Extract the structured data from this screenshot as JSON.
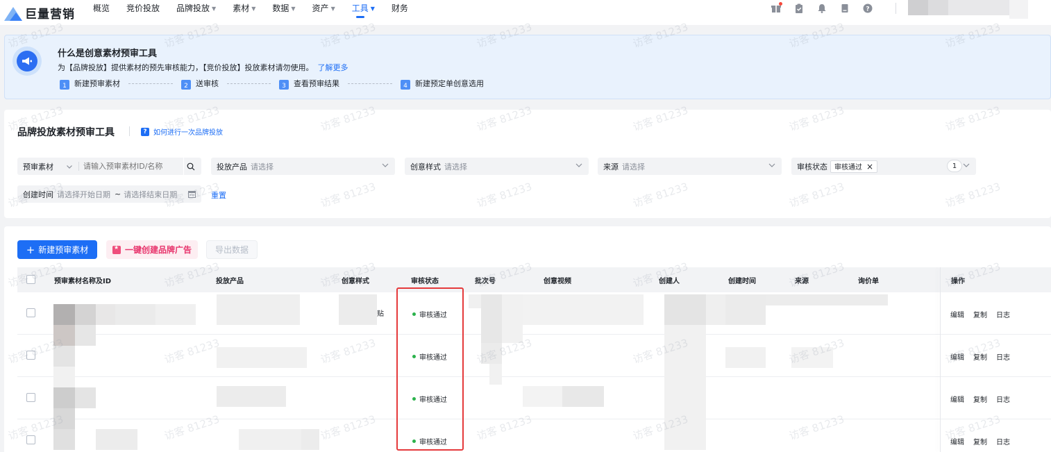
{
  "brand": {
    "name": "巨量营销"
  },
  "nav": {
    "items": [
      {
        "label": "概览",
        "dropdown": false
      },
      {
        "label": "竞价投放",
        "dropdown": false
      },
      {
        "label": "品牌投放",
        "dropdown": true
      },
      {
        "label": "素材",
        "dropdown": true
      },
      {
        "label": "数据",
        "dropdown": true
      },
      {
        "label": "资产",
        "dropdown": true
      },
      {
        "label": "工具",
        "dropdown": true,
        "active": true
      },
      {
        "label": "财务",
        "dropdown": false
      }
    ],
    "right_icons": [
      "gift-icon",
      "clipboard-icon",
      "bell-icon",
      "document-icon",
      "help-icon"
    ]
  },
  "banner": {
    "title": "什么是创意素材预审工具",
    "desc": "为【品牌投放】提供素材的预先审核能力，【竞价投放】投放素材请勿使用。",
    "link": "了解更多",
    "steps": [
      {
        "num": "1",
        "label": "新建预审素材"
      },
      {
        "num": "2",
        "label": "送审核"
      },
      {
        "num": "3",
        "label": "查看预审结果"
      },
      {
        "num": "4",
        "label": "新建预定单创意选用"
      }
    ]
  },
  "filters": {
    "title": "品牌投放素材预审工具",
    "howto": "如何进行一次品牌投放",
    "material": {
      "label": "预审素材",
      "placeholder": "请输入预审素材ID/名称"
    },
    "product": {
      "label": "投放产品",
      "placeholder": "请选择"
    },
    "style": {
      "label": "创意样式",
      "placeholder": "请选择"
    },
    "source": {
      "label": "来源",
      "placeholder": "请选择"
    },
    "status": {
      "label": "审核状态",
      "tag": "审核通过",
      "count": "1"
    },
    "date": {
      "label": "创建时间",
      "start": "请选择开始日期",
      "sep": "~",
      "end": "请选择结束日期"
    },
    "reset": "重置"
  },
  "toolbar": {
    "new_label": "新建预审素材",
    "brand_label": "一键创建品牌广告",
    "export_label": "导出数据"
  },
  "table": {
    "columns": [
      "预审素材名称及ID",
      "投放产品",
      "创意样式",
      "审核状态",
      "批次号",
      "创意视频",
      "创建人",
      "创建时间",
      "来源",
      "询价单",
      "操作"
    ],
    "rows": [
      {
        "status": "审核通过",
        "style_fragment": "贴"
      },
      {
        "status": "审核通过"
      },
      {
        "status": "审核通过"
      },
      {
        "status": "审核通过"
      }
    ],
    "actions": [
      "编辑",
      "复制",
      "日志"
    ]
  },
  "watermark": "访客 81233"
}
